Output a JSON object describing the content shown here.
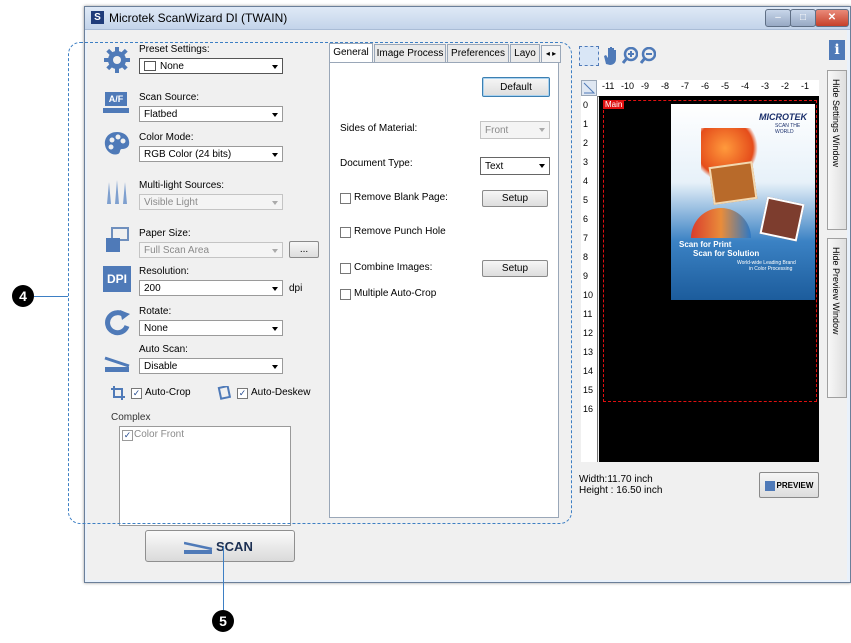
{
  "window": {
    "title": "Microtek ScanWizard DI (TWAIN)",
    "app_icon": "S",
    "min": "–",
    "max": "□",
    "close": "✕"
  },
  "left": {
    "preset_label": "Preset Settings:",
    "preset_value": "None",
    "scan_source_label": "Scan Source:",
    "scan_source_value": "Flatbed",
    "color_mode_label": "Color Mode:",
    "color_mode_value": "RGB Color (24 bits)",
    "multilight_label": "Multi-light Sources:",
    "multilight_value": "Visible Light",
    "paper_size_label": "Paper Size:",
    "paper_size_value": "Full Scan Area",
    "ellipsis": "...",
    "resolution_label": "Resolution:",
    "resolution_value": "200",
    "resolution_unit": "dpi",
    "dpi_icon_text": "DPI",
    "af_icon_text": "A/F",
    "rotate_label": "Rotate:",
    "rotate_value": "None",
    "autoscan_label": "Auto Scan:",
    "autoscan_value": "Disable",
    "autocrop_label": "Auto-Crop",
    "autodeskew_label": "Auto-Deskew",
    "complex_label": "Complex",
    "complex_item": "Color Front",
    "check": "✓"
  },
  "tabs": [
    "General",
    "Image Process",
    "Preferences",
    "Layo"
  ],
  "general": {
    "default_label": "Default",
    "sides_label": "Sides of Material:",
    "sides_value": "Front",
    "doc_type_label": "Document Type:",
    "doc_type_value": "Text",
    "remove_blank_label": "Remove Blank Page:",
    "remove_punch_label": "Remove Punch Hole",
    "combine_label": "Combine Images:",
    "multi_crop_label": "Multiple Auto-Crop",
    "setup_label": "Setup"
  },
  "preview": {
    "h_ticks": [
      "-11",
      "-10",
      "-9",
      "-8",
      "-7",
      "-6",
      "-5",
      "-4",
      "-3",
      "-2",
      "-1"
    ],
    "v_ticks": [
      "0",
      "1",
      "2",
      "3",
      "4",
      "5",
      "6",
      "7",
      "8",
      "9",
      "10",
      "11",
      "12",
      "13",
      "14",
      "15",
      "16"
    ],
    "main_tag": "Main",
    "brand": "MICROTEK",
    "brand_sub": "SCAN THE WORLD",
    "slogan1": "Scan for Print",
    "slogan2": "Scan for Solution",
    "slogan3": "World-wide Leading Brand",
    "slogan4": "in Color Processing",
    "width_text": "Width:11.70 inch",
    "height_text": "Height : 16.50 inch",
    "preview_label": "PREVIEW"
  },
  "side": {
    "hide_settings": "Hide  Settings Window",
    "hide_preview": "Hide  Preview Window",
    "info": "i"
  },
  "scan_label": "SCAN",
  "callouts": {
    "four": "4",
    "five": "5"
  }
}
